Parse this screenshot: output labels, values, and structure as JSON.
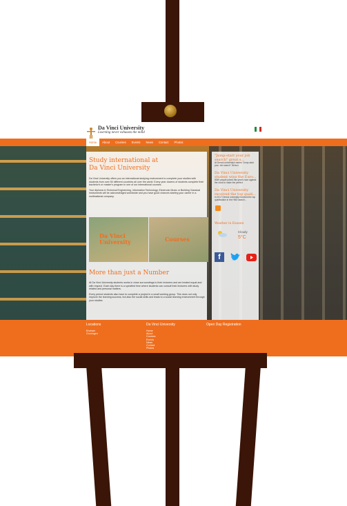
{
  "site": {
    "logo_title": "Da Vinci University",
    "logo_tagline": "Learning never exhausts the mind",
    "nav": [
      "Home",
      "About",
      "Courses",
      "Events",
      "News",
      "Contact",
      "Photos"
    ],
    "hero": {
      "title_line1": "Study international at",
      "title_line2": "Da Vinci University",
      "para1": "Da Vinci University offers you an international studying environment to complete your studies with students from over 50 different countries all over the world. Every year dozens of students complete their bachelor's or master's program in one of our international courses.",
      "para2": "Your diploma in Technical Engineering, Information Technology, Electronic Music or Building Classical Instruments will be acknowledged worldwide and you have good chances starting your career in a multinational company.",
      "tile1_line1": "Da Vinci",
      "tile1_line2": "University",
      "tile2": "Courses",
      "section2_title": "More than just a Number",
      "section2_para1": "At Da Vinci University students works in close surroundings to their lecturers and are treated equal and with respect. Each day there is a specified time where students can consult their lecturers with study related and personal matters.",
      "section2_para2": "Every period students also have to complete a project in a small working group. This does not only improve the learning success, but also the social skills and leads to a social learning environment through your studies."
    },
    "sidebar": {
      "news1_title": "\"Jump-start your job search\" great s...",
      "news1_text": "At Denvci university's series \"Jump-start your Job search\" Denvci.",
      "news2_title": "Da Vinci University student wins the Euro...",
      "news2_text": "8349 people joined this year's race against the clock to make the perfect",
      "news3_title": "Da Vinci University received the top quali...",
      "news3_text": "In 2017 Denvci university received the top qualification in the HBO search...",
      "weather_title": "Weather in Enuzen",
      "weather_condition": "Cloudy",
      "weather_temp": "5°C"
    },
    "footer": {
      "col1_title": "Locations",
      "col1_items": [
        "Enzham",
        "Groningen"
      ],
      "col2_title": "Da Vinci University",
      "col2_items": [
        "Home",
        "About",
        "Courses",
        "Events",
        "News",
        "Contact",
        "Photos"
      ],
      "col3_title": "Open Day Registration"
    },
    "colors": {
      "accent": "#ee6e1e",
      "easel": "#3a1508"
    }
  }
}
